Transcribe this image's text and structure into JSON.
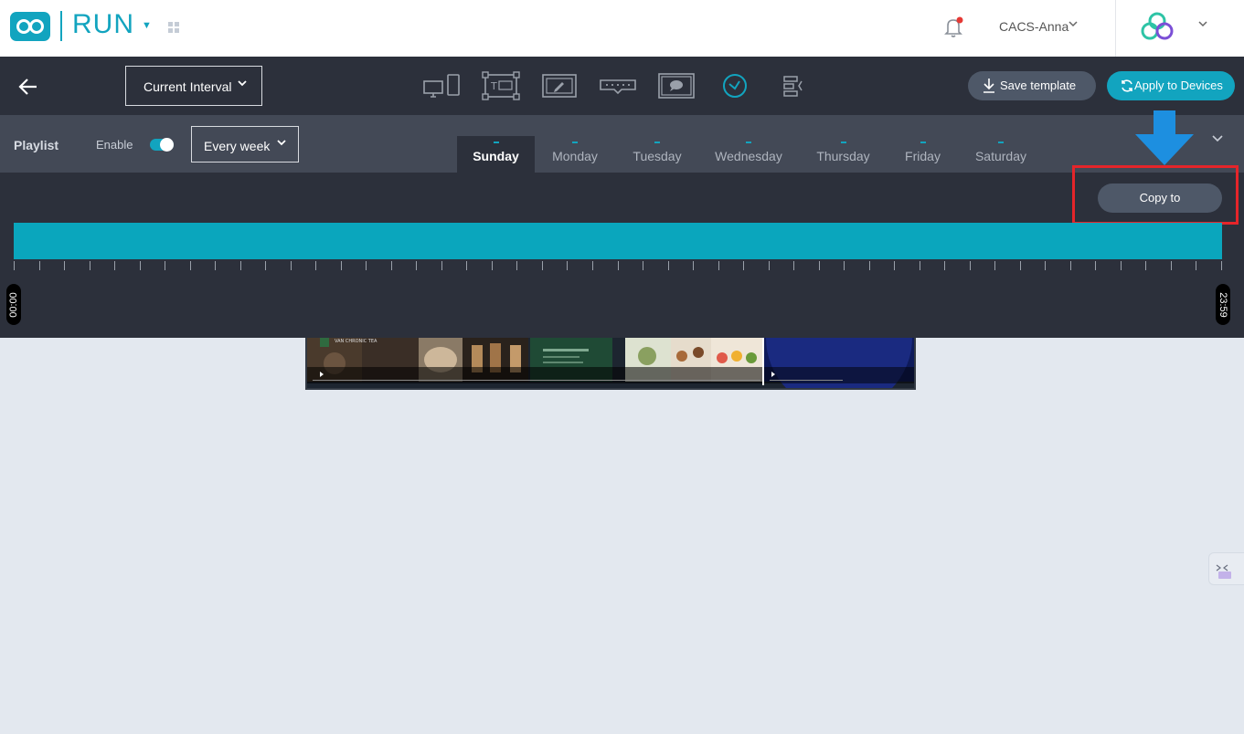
{
  "header": {
    "app_name": "RUN",
    "user_name": "CACS-Anna",
    "notification_dot_color": "#e53935",
    "brand_color": "#12a4bf"
  },
  "toolbar": {
    "interval_select": {
      "value": "Current Interval",
      "options_visible": [
        "Current Interval"
      ]
    },
    "tool_icons": [
      "screens-icon",
      "text-template-icon",
      "edit-frame-icon",
      "ticker-icon",
      "message-icon",
      "clock-icon",
      "align-icon"
    ],
    "active_tool": "clock-icon",
    "save_template_label": "Save template",
    "apply_devices_label": "Apply to Devices"
  },
  "playlist": {
    "label": "Playlist",
    "enable_label": "Enable",
    "enabled": true,
    "repeat_select": {
      "value": "Every week"
    },
    "days": [
      {
        "label": "Sunday",
        "active": true
      },
      {
        "label": "Monday",
        "active": false
      },
      {
        "label": "Tuesday",
        "active": false
      },
      {
        "label": "Wednesday",
        "active": false
      },
      {
        "label": "Thursday",
        "active": false
      },
      {
        "label": "Friday",
        "active": false
      },
      {
        "label": "Saturday",
        "active": false
      }
    ]
  },
  "timeline": {
    "copy_to_label": "Copy to",
    "start_time": "00:00",
    "end_time": "23:59",
    "bar_color": "#0aa6bd",
    "highlight_color": "#e5252a",
    "arrow_color": "#1d8fe0"
  },
  "preview": {
    "brand_text": "VAN CHRONIC TEA"
  }
}
